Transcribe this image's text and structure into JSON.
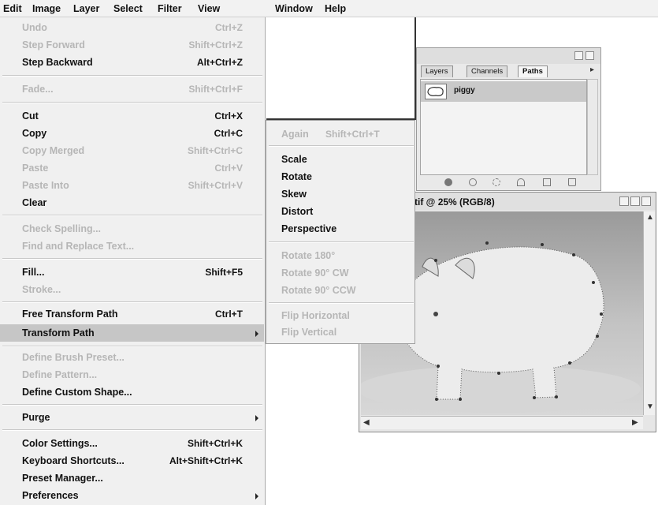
{
  "menubar": {
    "items": [
      "Edit",
      "Image",
      "Layer",
      "Select",
      "Filter",
      "View",
      "Window",
      "Help"
    ]
  },
  "edit_menu": {
    "items": [
      {
        "label": "Undo",
        "shortcut": "Ctrl+Z",
        "enabled": false
      },
      {
        "label": "Step Forward",
        "shortcut": "Shift+Ctrl+Z",
        "enabled": false
      },
      {
        "label": "Step Backward",
        "shortcut": "Alt+Ctrl+Z",
        "enabled": true
      },
      {
        "label": "Fade...",
        "shortcut": "Shift+Ctrl+F",
        "enabled": false
      },
      {
        "label": "Cut",
        "shortcut": "Ctrl+X",
        "enabled": true
      },
      {
        "label": "Copy",
        "shortcut": "Ctrl+C",
        "enabled": true
      },
      {
        "label": "Copy Merged",
        "shortcut": "Shift+Ctrl+C",
        "enabled": false
      },
      {
        "label": "Paste",
        "shortcut": "Ctrl+V",
        "enabled": false
      },
      {
        "label": "Paste Into",
        "shortcut": "Shift+Ctrl+V",
        "enabled": false
      },
      {
        "label": "Clear",
        "shortcut": "",
        "enabled": true
      },
      {
        "label": "Check Spelling...",
        "shortcut": "",
        "enabled": false
      },
      {
        "label": "Find and Replace Text...",
        "shortcut": "",
        "enabled": false
      },
      {
        "label": "Fill...",
        "shortcut": "Shift+F5",
        "enabled": true
      },
      {
        "label": "Stroke...",
        "shortcut": "",
        "enabled": false
      },
      {
        "label": "Free Transform Path",
        "shortcut": "Ctrl+T",
        "enabled": true
      },
      {
        "label": "Transform Path",
        "shortcut": "",
        "enabled": true,
        "submenu": true,
        "highlighted": true
      },
      {
        "label": "Define Brush Preset...",
        "shortcut": "",
        "enabled": false
      },
      {
        "label": "Define Pattern...",
        "shortcut": "",
        "enabled": false
      },
      {
        "label": "Define Custom Shape...",
        "shortcut": "",
        "enabled": true
      },
      {
        "label": "Purge",
        "shortcut": "",
        "enabled": true,
        "submenu": true
      },
      {
        "label": "Color Settings...",
        "shortcut": "Shift+Ctrl+K",
        "enabled": true
      },
      {
        "label": "Keyboard Shortcuts...",
        "shortcut": "Alt+Shift+Ctrl+K",
        "enabled": true
      },
      {
        "label": "Preset Manager...",
        "shortcut": "",
        "enabled": true
      },
      {
        "label": "Preferences",
        "shortcut": "",
        "enabled": true,
        "submenu": true
      }
    ]
  },
  "transform_submenu": {
    "items": [
      {
        "label": "Again",
        "shortcut": "Shift+Ctrl+T",
        "enabled": false
      },
      {
        "label": "Scale",
        "shortcut": "",
        "enabled": true
      },
      {
        "label": "Rotate",
        "shortcut": "",
        "enabled": true
      },
      {
        "label": "Skew",
        "shortcut": "",
        "enabled": true
      },
      {
        "label": "Distort",
        "shortcut": "",
        "enabled": true
      },
      {
        "label": "Perspective",
        "shortcut": "",
        "enabled": true
      },
      {
        "label": "Rotate 180°",
        "shortcut": "",
        "enabled": false
      },
      {
        "label": "Rotate 90° CW",
        "shortcut": "",
        "enabled": false
      },
      {
        "label": "Rotate 90° CCW",
        "shortcut": "",
        "enabled": false
      },
      {
        "label": "Flip Horizontal",
        "shortcut": "",
        "enabled": false
      },
      {
        "label": "Flip Vertical",
        "shortcut": "",
        "enabled": false
      }
    ]
  },
  "paths_panel": {
    "tabs": [
      "Layers",
      "Channels",
      "Paths"
    ],
    "active_tab": "Paths",
    "path_name": "piggy"
  },
  "document": {
    "title": "tif @ 25% (RGB/8)"
  },
  "colors": {
    "menu_bg": "#f0f0f0",
    "highlight": "#c6c6c6",
    "disabled_text": "#b6b6b6"
  }
}
